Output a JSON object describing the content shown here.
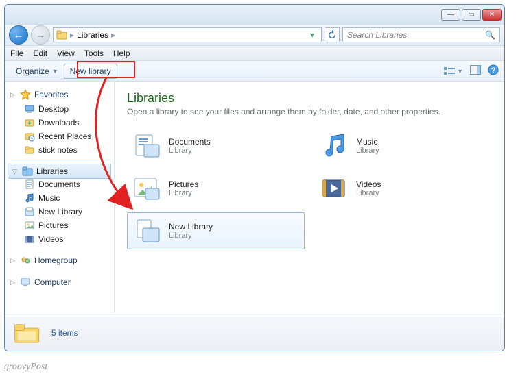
{
  "window": {
    "minimize_tip": "Minimize",
    "maximize_tip": "Maximize",
    "close_tip": "Close"
  },
  "nav": {
    "back_tip": "Back",
    "forward_tip": "Forward",
    "path_seg": "Libraries",
    "refresh_tip": "Refresh"
  },
  "search": {
    "placeholder": "Search Libraries"
  },
  "menu": {
    "file": "File",
    "edit": "Edit",
    "view": "View",
    "tools": "Tools",
    "help": "Help"
  },
  "toolbar": {
    "organize": "Organize",
    "new_library": "New library",
    "views_tip": "Change your view",
    "preview_tip": "Show the preview pane",
    "help_tip": "Get help"
  },
  "sidebar": {
    "favorites": {
      "label": "Favorites",
      "items": [
        {
          "label": "Desktop",
          "icon": "desktop"
        },
        {
          "label": "Downloads",
          "icon": "download"
        },
        {
          "label": "Recent Places",
          "icon": "recent"
        },
        {
          "label": "stick notes",
          "icon": "folder"
        }
      ]
    },
    "libraries": {
      "label": "Libraries",
      "items": [
        {
          "label": "Documents",
          "icon": "doc"
        },
        {
          "label": "Music",
          "icon": "music"
        },
        {
          "label": "New Library",
          "icon": "newlib"
        },
        {
          "label": "Pictures",
          "icon": "pic"
        },
        {
          "label": "Videos",
          "icon": "vid"
        }
      ]
    },
    "homegroup": {
      "label": "Homegroup"
    },
    "computer": {
      "label": "Computer"
    }
  },
  "content": {
    "title": "Libraries",
    "subtitle": "Open a library to see your files and arrange them by folder, date, and other properties.",
    "items": [
      {
        "name": "Documents",
        "kind": "Library",
        "icon": "doc"
      },
      {
        "name": "Music",
        "kind": "Library",
        "icon": "music"
      },
      {
        "name": "Pictures",
        "kind": "Library",
        "icon": "pic"
      },
      {
        "name": "Videos",
        "kind": "Library",
        "icon": "vid"
      },
      {
        "name": "New Library",
        "kind": "Library",
        "icon": "newlib",
        "selected": true
      }
    ]
  },
  "status": {
    "count": "5 items"
  },
  "attribution": "groovyPost"
}
